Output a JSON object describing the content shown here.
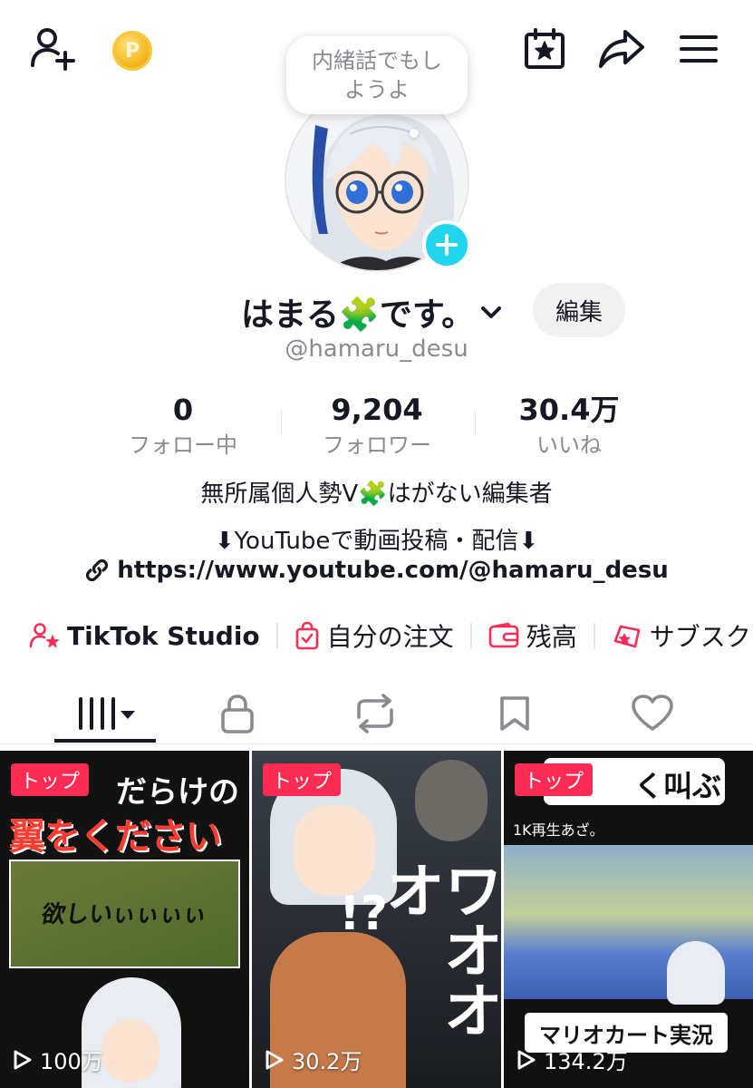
{
  "bubble_text": "内緒話でもしようよ",
  "profile": {
    "display_name": "はまる🧩です。",
    "username": "@hamaru_desu",
    "edit_label": "編集"
  },
  "stats": [
    {
      "value": "0",
      "label": "フォロー中"
    },
    {
      "value": "9,204",
      "label": "フォロワー"
    },
    {
      "value": "30.4万",
      "label": "いいね"
    }
  ],
  "bio": {
    "line1": "無所属個人勢V🧩はがない編集者",
    "line2": "⬇YouTubeで動画投稿・配信⬇",
    "link": "https://www.youtube.com/@hamaru_desu"
  },
  "shortcuts": [
    {
      "label": "TikTok Studio",
      "icon": "creator-star-icon"
    },
    {
      "label": "自分の注文",
      "icon": "shopping-bag-icon"
    },
    {
      "label": "残高",
      "icon": "wallet-icon"
    },
    {
      "label": "サブスク",
      "icon": "subscription-icon"
    }
  ],
  "tabs": [
    {
      "name": "videos",
      "icon": "grid-icon"
    },
    {
      "name": "private",
      "icon": "lock-icon"
    },
    {
      "name": "reposts",
      "icon": "repost-icon"
    },
    {
      "name": "favorites",
      "icon": "bookmark-icon"
    },
    {
      "name": "liked",
      "icon": "heart-icon"
    }
  ],
  "videos": [
    {
      "badge": "トップ",
      "views": "100万",
      "title_top": "だらけの",
      "title_main": "翼をください",
      "caption": "欲しいぃぃぃぃ"
    },
    {
      "badge": "トップ",
      "views": "30.2万",
      "title_main": "ワオオオ",
      "caption": "!?"
    },
    {
      "badge": "トップ",
      "views": "134.2万",
      "title_top": "く叫ぶ",
      "sub_caption": "1K再生あざ。",
      "title_main": "マリオカート実況"
    }
  ],
  "colors": {
    "accent_red": "#fe2c55",
    "avatar_add": "#20d5ec",
    "text_primary": "#161823",
    "text_secondary": "#8a8b91"
  }
}
